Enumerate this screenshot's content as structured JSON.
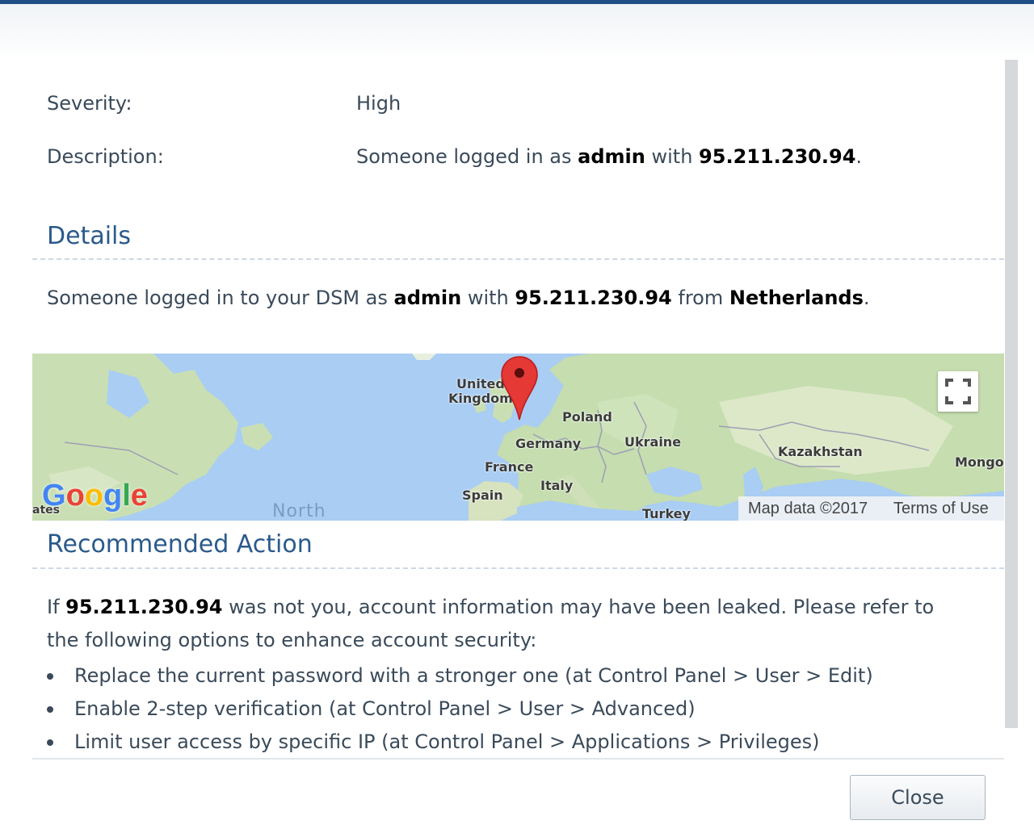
{
  "summary": {
    "severity_label": "Severity:",
    "severity_value": "High",
    "description_label": "Description:",
    "description": {
      "prefix": "Someone logged in as ",
      "user": "admin",
      "middle": " with ",
      "ip": "95.211.230.94",
      "suffix": "."
    }
  },
  "details": {
    "title": "Details",
    "sentence": {
      "prefix": "Someone logged in to your DSM as ",
      "user": "admin",
      "with": " with ",
      "ip": "95.211.230.94",
      "from": " from ",
      "country": "Netherlands",
      "suffix": "."
    }
  },
  "map": {
    "labels": {
      "uk_line1": "United",
      "uk_line2": "Kingdom",
      "poland": "Poland",
      "germany": "Germany",
      "ukraine": "Ukraine",
      "france": "France",
      "kazakhstan": "Kazakhstan",
      "mongolia": "Mongo",
      "italy": "Italy",
      "spain": "Spain",
      "turkey": "Turkey",
      "states": "ates",
      "north": "North"
    },
    "logo": {
      "G": "G",
      "o1": "o",
      "o2": "o",
      "g": "g",
      "l": "l",
      "e": "e"
    },
    "map_data_text": "Map data ©2017",
    "terms_link": "Terms of Use",
    "marker_color": "#e53935",
    "water_color": "#a9cdf3",
    "land_color": "#c8dfb4"
  },
  "recommended": {
    "title": "Recommended Action",
    "intro_prefix": "If ",
    "intro_ip": "95.211.230.94",
    "intro_suffix": " was not you, account information may have been leaked. Please refer to",
    "intro_line2": "the following options to enhance account security:",
    "bullets": [
      "Replace the current password with a stronger one (at Control Panel > User > Edit)",
      "Enable 2-step verification (at Control Panel > User > Advanced)",
      "Limit user access by specific IP (at Control Panel > Applications > Privileges)"
    ]
  },
  "footer": {
    "close_label": "Close"
  },
  "colors": {
    "title_accent": "#1d4f86",
    "section_heading": "#2a5a8c",
    "body_text": "#3a4a5a"
  }
}
